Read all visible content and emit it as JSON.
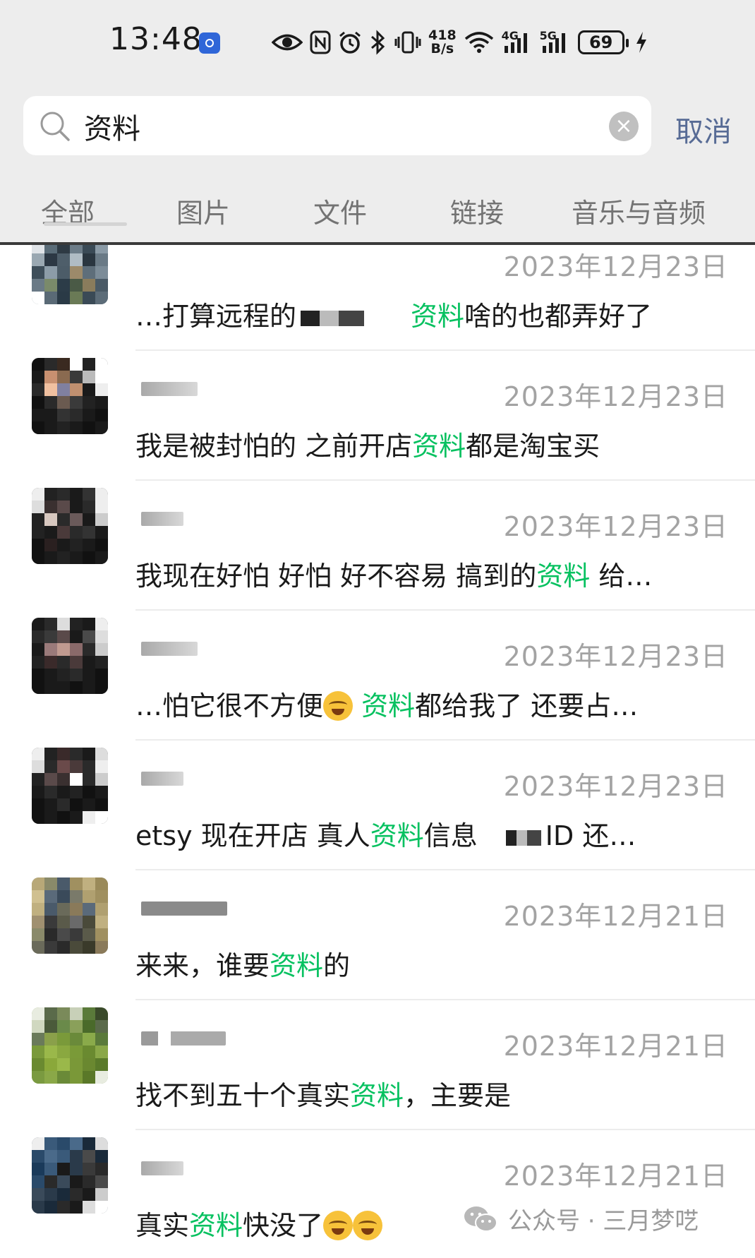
{
  "status_bar": {
    "time": "13:48",
    "net_speed_top": "418",
    "net_speed_bottom": "B/s",
    "signal1": "4G",
    "signal2": "5G",
    "battery": "69",
    "icons": [
      "eye-icon",
      "nfc-icon",
      "alarm-icon",
      "bluetooth-icon",
      "vibrate-icon",
      "wifi-icon",
      "signal-icon",
      "signal-icon",
      "battery-icon",
      "charging-icon"
    ]
  },
  "search": {
    "value": "资料",
    "cancel_label": "取消"
  },
  "tabs": [
    {
      "label": "全部"
    },
    {
      "label": "图片"
    },
    {
      "label": "文件"
    },
    {
      "label": "链接"
    },
    {
      "label": "音乐与音频"
    }
  ],
  "results": [
    {
      "date": "2023年12月23日",
      "pre": "…打算远程的",
      "hl": "资料",
      "post": "啥的也都弄好了"
    },
    {
      "date": "2023年12月23日",
      "pre": "我是被封怕的  之前开店",
      "hl": "资料",
      "post": "都是淘宝买"
    },
    {
      "date": "2023年12月23日",
      "pre": "我现在好怕 好怕  好不容易 搞到的",
      "hl": "资料",
      "post": " 给…"
    },
    {
      "date": "2023年12月23日",
      "pre": "…怕它很不方便",
      "hl": "资料",
      "post": "都给我了  还要占…"
    },
    {
      "date": "2023年12月23日",
      "pre": "etsy  现在开店  真人",
      "hl": "资料",
      "post": "信息",
      "post2": "ID  还…"
    },
    {
      "date": "2023年12月21日",
      "pre": "来来，谁要",
      "hl": "资料",
      "post": "的"
    },
    {
      "date": "2023年12月21日",
      "pre": "找不到五十个真实",
      "hl": "资料",
      "post": "，主要是"
    },
    {
      "date": "2023年12月21日",
      "pre": "真实",
      "hl": "资料",
      "post": "快没了"
    }
  ],
  "watermark": {
    "text": "公众号 · 三月梦呓",
    "icon": "wechat-icon"
  },
  "colors": {
    "highlight": "#07c160",
    "link": "#576b95",
    "date": "#a3a3a3",
    "header_bg": "#ededed"
  }
}
